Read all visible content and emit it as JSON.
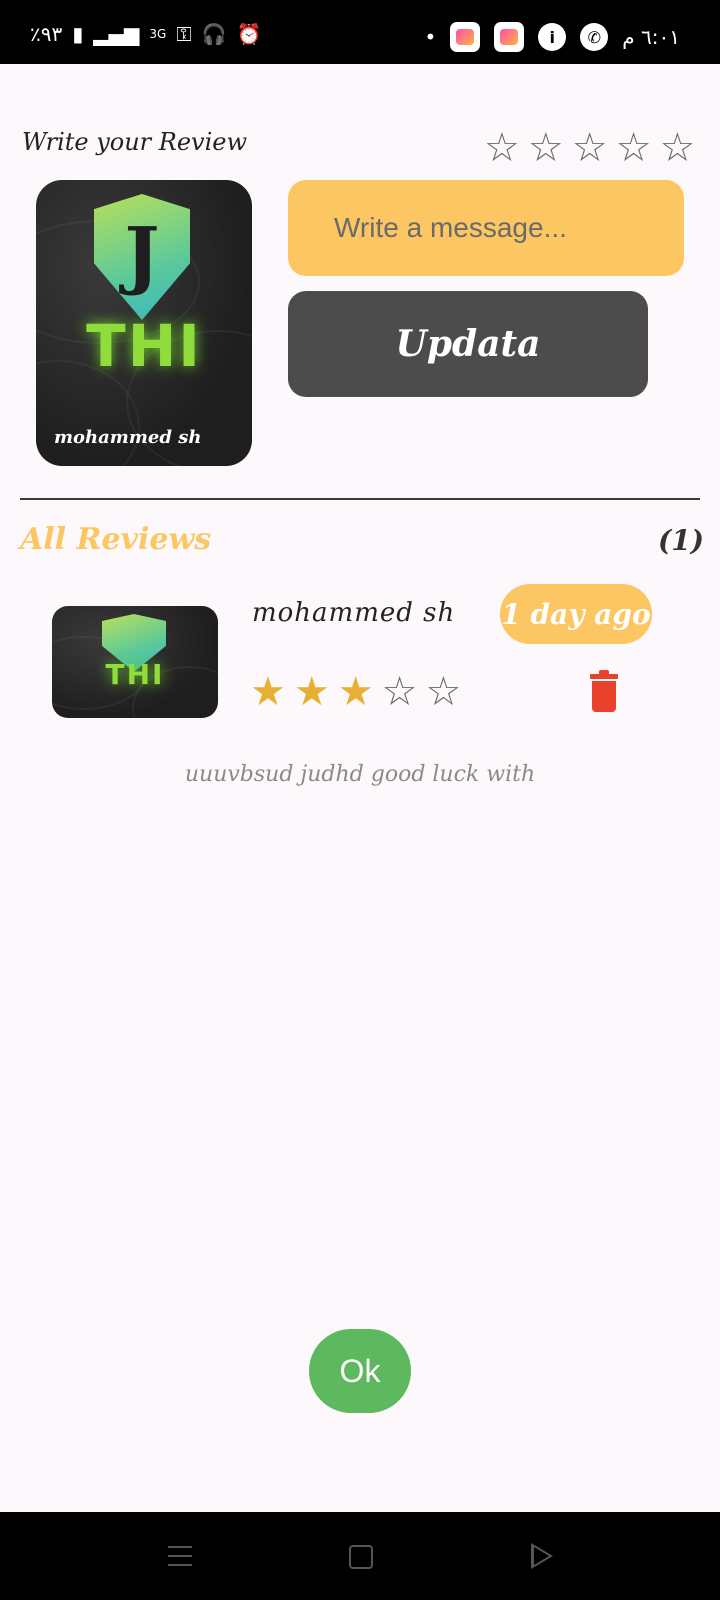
{
  "status_bar": {
    "battery": "٪٩٣",
    "network": "3G",
    "time": "٦:٠١ م"
  },
  "write_review": {
    "title": "Write your Review",
    "rating": 0,
    "cover_name": "mohammed sh",
    "cover_brand": "THI",
    "message_placeholder": "Write a message...",
    "update_label": "Updata"
  },
  "all_reviews": {
    "title": "All Reviews",
    "count": "(1)"
  },
  "review": {
    "user": "mohammed sh",
    "time": "1 day ago",
    "rating": 3,
    "thumb_brand": "THI",
    "comment": "uuuvbsud judhd good luck with"
  },
  "ok_label": "Ok",
  "colors": {
    "accent": "#fcc662",
    "dark_button": "#4c4c4c",
    "ok_button": "#5eb95e",
    "star_filled": "#e6b034",
    "delete": "#e8412c",
    "background": "#fdf8fb"
  }
}
